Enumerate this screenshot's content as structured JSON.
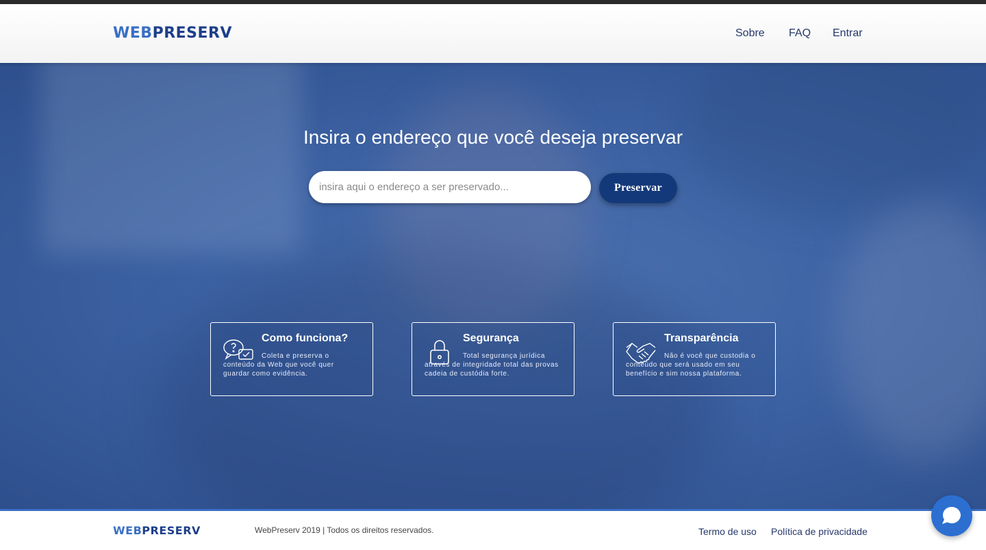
{
  "header": {
    "logo_part1": "WEB",
    "logo_part2": "PRESERV",
    "nav": [
      "Sobre",
      "FAQ",
      "Entrar"
    ]
  },
  "hero": {
    "title": "Insira o endereço que você deseja preservar",
    "search_placeholder": "insira aqui o endereço a ser preservado...",
    "button_label": "Preservar"
  },
  "features": [
    {
      "icon": "chat-question-icon",
      "title": "Como funciona?",
      "description": "Coleta e preserva o conteúdo da Web que você quer guardar como evidência."
    },
    {
      "icon": "padlock-icon",
      "title": "Segurança",
      "description": "Total segurança jurídica através de integridade total das provas cadeia de custódia forte."
    },
    {
      "icon": "handshake-icon",
      "title": "Transparência",
      "description": "Não é você que custodia o conteúdo que será usado em seu benefício e sim nossa plataforma."
    }
  ],
  "footer": {
    "logo_part1": "WEB",
    "logo_part2": "PRESERV",
    "copyright": "WebPreserv 2019 | Todos os direitos reservados.",
    "links": [
      "Termo de uso",
      "Política de privacidade"
    ]
  },
  "colors": {
    "brand_dark": "#1d3f8a",
    "brand_light": "#3a6fc4",
    "button": "#14397a",
    "chat_button": "#2c6fd1"
  }
}
